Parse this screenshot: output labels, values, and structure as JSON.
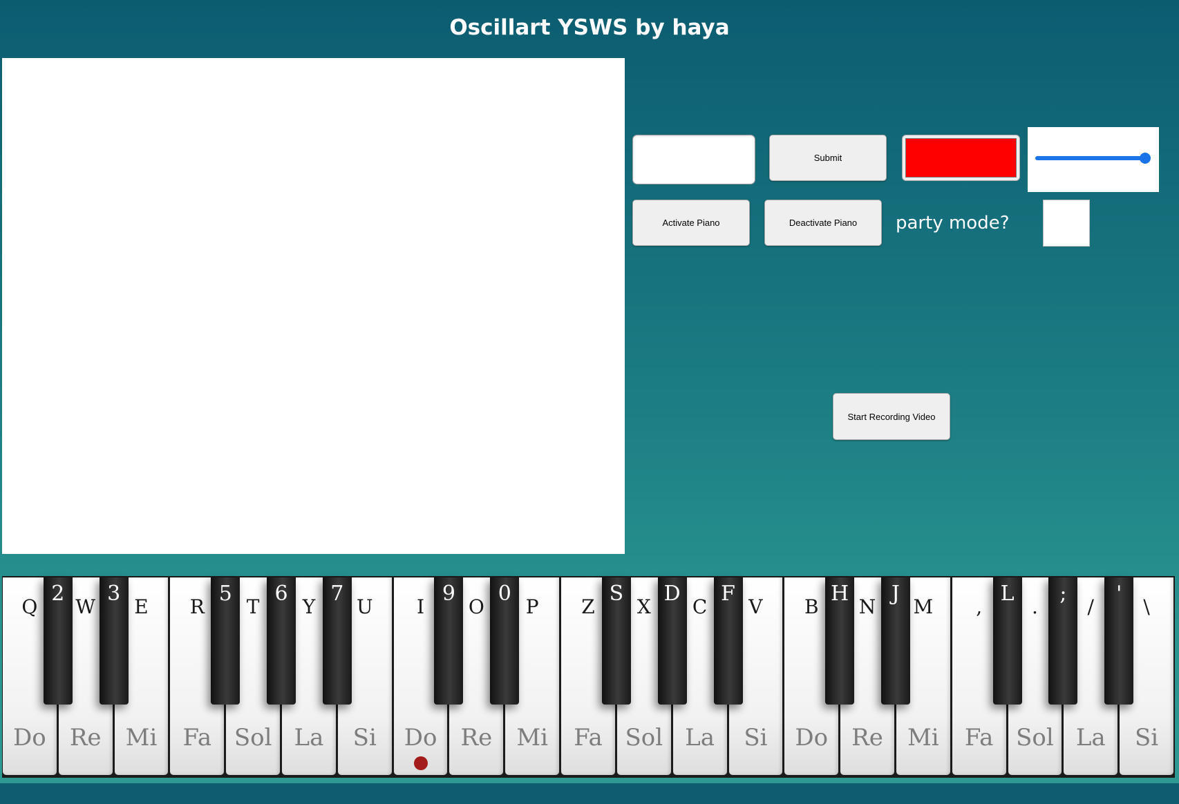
{
  "header": {
    "title": "Oscillart YSWS by haya"
  },
  "controls": {
    "text_input_value": "",
    "submit_label": "Submit",
    "color_value": "#ff0000",
    "slider_value_fraction": 1.0,
    "activate_label": "Activate Piano",
    "deactivate_label": "Deactivate Piano",
    "party_label": "party mode?",
    "party_checked": false,
    "record_label": "Start Recording Video"
  },
  "piano": {
    "white_keys": [
      {
        "key": "Q",
        "note": "Do"
      },
      {
        "key": "W",
        "note": "Re"
      },
      {
        "key": "E",
        "note": "Mi"
      },
      {
        "key": "R",
        "note": "Fa"
      },
      {
        "key": "T",
        "note": "Sol"
      },
      {
        "key": "Y",
        "note": "La"
      },
      {
        "key": "U",
        "note": "Si"
      },
      {
        "key": "I",
        "note": "Do",
        "middle_c": true
      },
      {
        "key": "O",
        "note": "Re"
      },
      {
        "key": "P",
        "note": "Mi"
      },
      {
        "key": "Z",
        "note": "Fa"
      },
      {
        "key": "X",
        "note": "Sol"
      },
      {
        "key": "C",
        "note": "La"
      },
      {
        "key": "V",
        "note": "Si"
      },
      {
        "key": "B",
        "note": "Do"
      },
      {
        "key": "N",
        "note": "Re"
      },
      {
        "key": "M",
        "note": "Mi"
      },
      {
        "key": ",",
        "note": "Fa"
      },
      {
        "key": ".",
        "note": "Sol"
      },
      {
        "key": "/",
        "note": "La"
      },
      {
        "key": "\\",
        "note": "Si"
      }
    ],
    "black_keys": [
      {
        "key": "2",
        "after_white": 0
      },
      {
        "key": "3",
        "after_white": 1
      },
      {
        "key": "5",
        "after_white": 3
      },
      {
        "key": "6",
        "after_white": 4
      },
      {
        "key": "7",
        "after_white": 5
      },
      {
        "key": "9",
        "after_white": 7
      },
      {
        "key": "0",
        "after_white": 8
      },
      {
        "key": "S",
        "after_white": 10
      },
      {
        "key": "D",
        "after_white": 11
      },
      {
        "key": "F",
        "after_white": 12
      },
      {
        "key": "H",
        "after_white": 14
      },
      {
        "key": "J",
        "after_white": 15
      },
      {
        "key": "L",
        "after_white": 17
      },
      {
        "key": ";",
        "after_white": 18
      },
      {
        "key": "'",
        "after_white": 19
      }
    ]
  }
}
